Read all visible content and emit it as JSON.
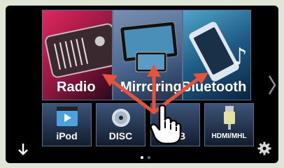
{
  "big_tiles": [
    {
      "label": "Radio"
    },
    {
      "label": "Mirroring"
    },
    {
      "label": "Bluetooth"
    }
  ],
  "small_tiles": [
    {
      "label": "iPod"
    },
    {
      "label": "DISC"
    },
    {
      "label": "USB"
    },
    {
      "label": "HDMI/MHL"
    }
  ],
  "icons": {
    "next_page": "chevron-right-icon",
    "scroll_down": "arrow-down-icon",
    "settings": "gear-icon",
    "gesture": "hand-pointer-icon"
  },
  "pager": {
    "current_page": 1,
    "total_pages": 2
  },
  "colors": {
    "arrow": "#e8513a",
    "tile_border": "#5a6e8c",
    "background": "#000000"
  }
}
